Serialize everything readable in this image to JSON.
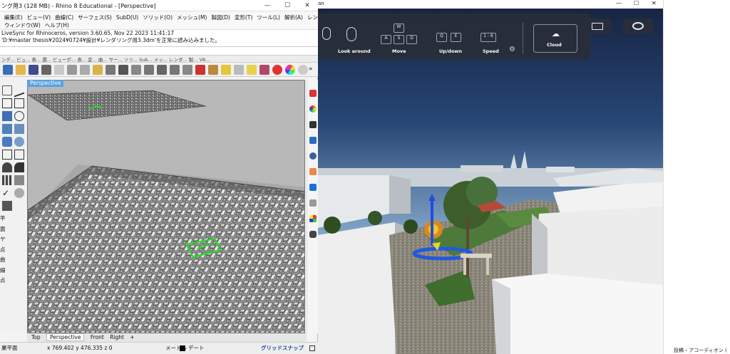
{
  "rhino": {
    "title": "ング用3 (128 MB) - Rhino 8 Educational - [Perspective]",
    "window_controls": [
      "—",
      "☐",
      "✕"
    ],
    "menu_row1": [
      "編集(E)",
      "ビュー(V)",
      "曲線(C)",
      "サーフェス(S)",
      "SubD(U)",
      "ソリッド(O)",
      "メッシュ(M)",
      "製図(D)",
      "変形(T)",
      "ツール(L)",
      "解析(A)",
      "レンダリング(R)"
    ],
    "menu_row2": [
      "ウィンドウ(W)",
      "ヘルプ(H)"
    ],
    "command_history": [
      "LiveSync for Rhinoceros, version 3.60.65, Nov 22 2023  11:41:17",
      "'D:¥master thesis¥2024¥0724¥設計¥レンダリング用3.3dm'を正常に読み込みました。"
    ],
    "toolbar_tabs": "ンデ...  ビュ...  表...  選...  ビューポ...  表...  変...  曲...  サー...  ソリ...  Sub...  メッ...  レンダ...  製...  V8...",
    "more_chevron": "»",
    "viewport_label": "Perspective",
    "viewport_tabs": [
      "Top",
      "Perspective",
      "Front",
      "Right"
    ],
    "viewport_tab_add": "+",
    "left_labels": [
      "平面",
      "ヤ",
      "点",
      "曲",
      "線",
      "点"
    ],
    "status": {
      "left": "業平面",
      "coords": "x 769.402   y 476.335   z 0",
      "units": "メートル",
      "layer": "デート",
      "snap": "グリッドスナップ"
    }
  },
  "render": {
    "top_label": "an",
    "controls": [
      {
        "label": "Look around",
        "keys": []
      },
      {
        "label": "Move",
        "keys": [
          "W",
          "A",
          "S",
          "D"
        ]
      },
      {
        "label": "Up/down",
        "keys": [
          "Q",
          "E"
        ]
      },
      {
        "label": "Speed",
        "keys": [
          "1 - 6"
        ]
      },
      {
        "label": "Cloud",
        "keys": []
      }
    ],
    "window_controls": [
      "—",
      "☐",
      "✕"
    ]
  },
  "side": {
    "breadcrumb": "投稿  ›  アコーディオン  ("
  },
  "colors": {
    "rhino_blue": "#5aa0e0",
    "sky_top": "#1d2c4e",
    "sky_bottom": "#bcd3e6",
    "panel_bg": "#282e38",
    "selection_green": "#22e022"
  }
}
